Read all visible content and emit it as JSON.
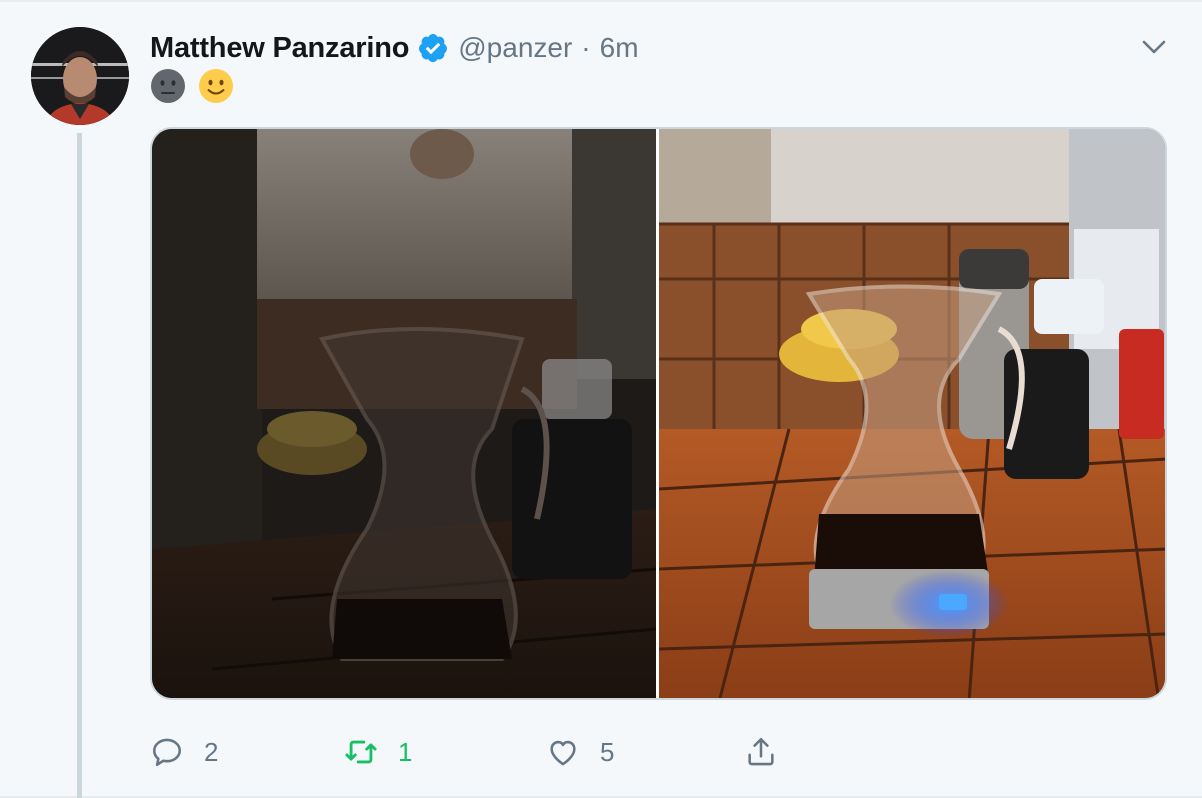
{
  "tweet": {
    "author_name": "Matthew Panzarino",
    "handle": "@panzer",
    "separator": "·",
    "timestamp": "6m",
    "verified": true,
    "body_emojis": [
      "neutral-face-emoji",
      "slightly-smiling-face-emoji"
    ],
    "media_count": 2,
    "media": [
      {
        "name": "photo-coffee-carafe-dark"
      },
      {
        "name": "photo-coffee-carafe-bright"
      }
    ]
  },
  "actions": {
    "reply_count": "2",
    "retweet_count": "1",
    "like_count": "5"
  },
  "colors": {
    "background": "#f5f8fa",
    "verified_blue": "#1da1f2",
    "retweet_green": "#17bf63",
    "secondary_text": "#657786",
    "thread_line": "#ccd6dd"
  }
}
